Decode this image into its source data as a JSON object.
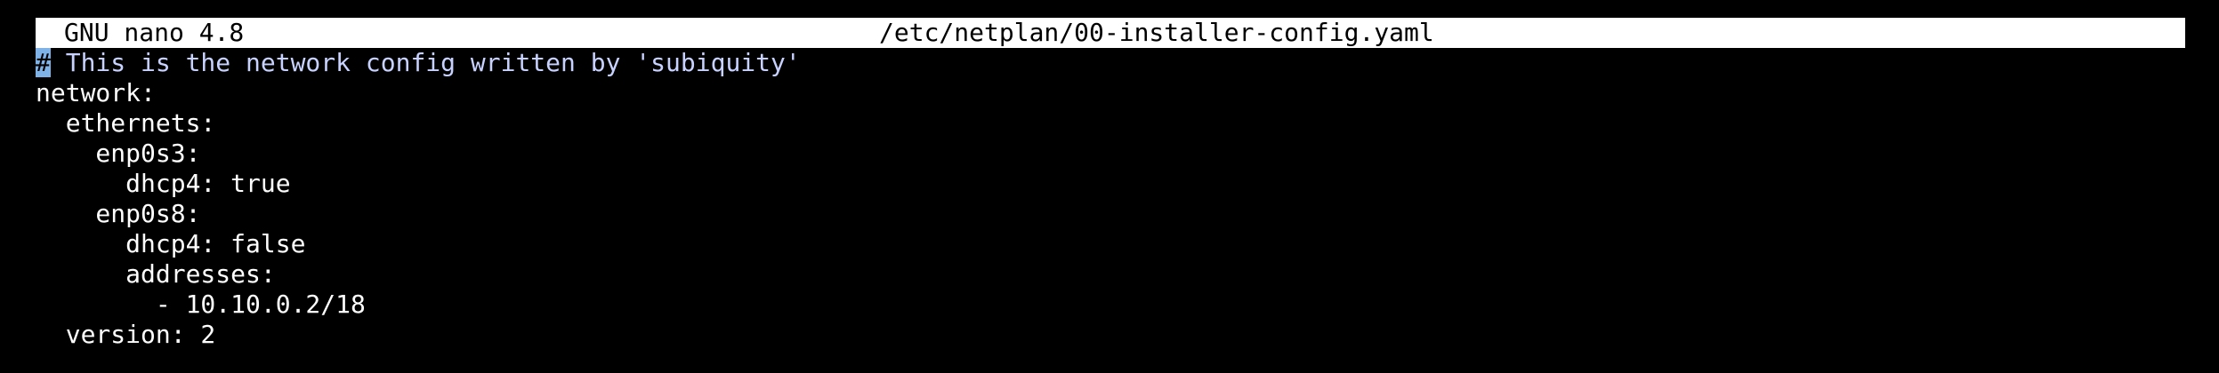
{
  "titlebar": {
    "app": "GNU nano 4.8",
    "filename": "/etc/netplan/00-installer-config.yaml"
  },
  "editor": {
    "cursor_char": "#",
    "comment_rest": " This is the network config written by 'subiquity'",
    "lines": [
      "network:",
      "  ethernets:",
      "    enp0s3:",
      "      dhcp4: true",
      "    enp0s8:",
      "      dhcp4: false",
      "      addresses:",
      "        - 10.10.0.2/18",
      "  version: 2"
    ]
  },
  "colors": {
    "background": "#000000",
    "text": "#ffffff",
    "titlebar_bg": "#ffffff",
    "comment": "#c8d2ff",
    "cursor_bg": "#7fb2e6"
  }
}
